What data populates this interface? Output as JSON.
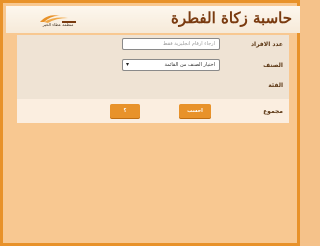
{
  "header": {
    "title": "حاسبة زكاة الفطرة",
    "logo_text": "منظمة عطاء الخير"
  },
  "form": {
    "count_label": "عدد الافراد",
    "count_placeholder": "ارجاء ارقام انجليزية فقط",
    "category_label": "الصنف",
    "category_selected": "اختيار الصنف من القائمة",
    "type_label": "الفئة",
    "total_label": "مجموع"
  },
  "buttons": {
    "calc": "احسب",
    "reset": "؟"
  },
  "colors": {
    "accent": "#e8922a",
    "background": "#f8c891",
    "title": "#7a3b10"
  }
}
